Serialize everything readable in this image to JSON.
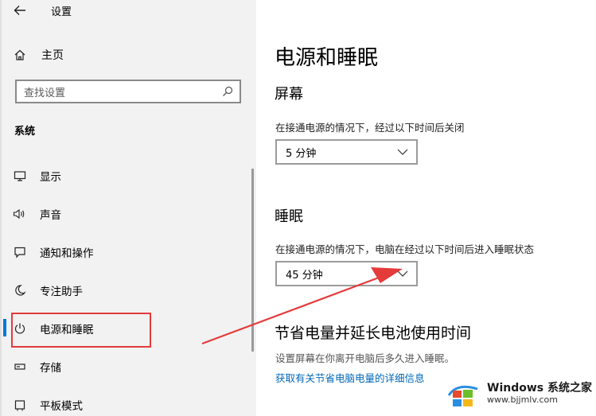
{
  "app": {
    "title": "设置"
  },
  "sidebar": {
    "home_label": "主页",
    "search_placeholder": "查找设置",
    "section_title": "系统",
    "items": [
      {
        "label": "显示",
        "icon": "monitor-icon"
      },
      {
        "label": "声音",
        "icon": "speaker-icon"
      },
      {
        "label": "通知和操作",
        "icon": "notification-icon"
      },
      {
        "label": "专注助手",
        "icon": "moon-icon"
      },
      {
        "label": "电源和睡眠",
        "icon": "power-icon",
        "active": true
      },
      {
        "label": "存储",
        "icon": "storage-icon"
      },
      {
        "label": "平板模式",
        "icon": "tablet-icon"
      }
    ]
  },
  "main": {
    "title": "电源和睡眠",
    "screen": {
      "heading": "屏幕",
      "description": "在接通电源的情况下，经过以下时间后关闭",
      "value": "5 分钟"
    },
    "sleep": {
      "heading": "睡眠",
      "description": "在接通电源的情况下，电脑在经过以下时间后进入睡眠状态",
      "value": "45 分钟"
    },
    "battery": {
      "heading": "节省电量并延长电池使用时间",
      "description": "设置屏幕在你离开电脑后多久进入睡眠。",
      "link": "获取有关节省电脑电量的详细信息"
    }
  },
  "watermark": {
    "brand": "Windows",
    "brand_cn": "系统之家",
    "url": "www.bjjmlv.com"
  },
  "colors": {
    "accent": "#0078d7",
    "annotation_red": "#e43b3b",
    "link": "#0067b8",
    "sidebar_bg": "#f2f2f2"
  }
}
